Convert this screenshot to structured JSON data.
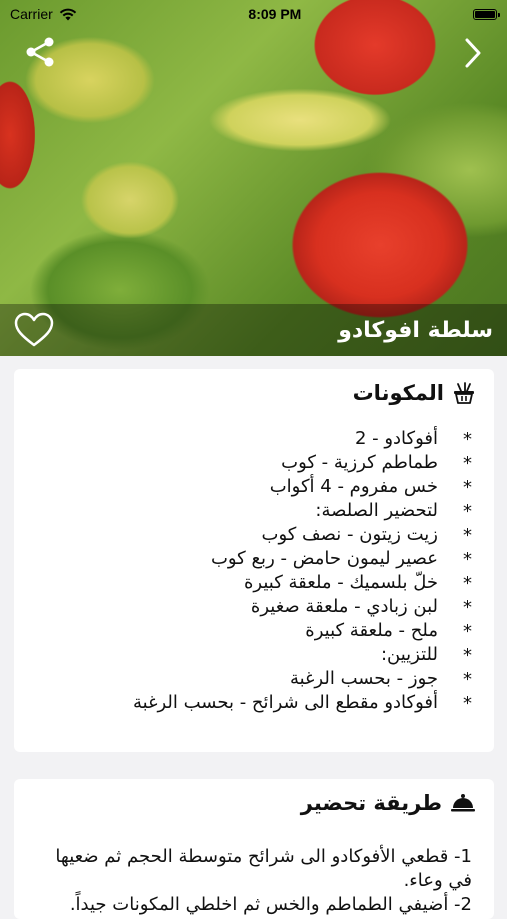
{
  "status_bar": {
    "carrier": "Carrier",
    "time": "8:09 PM"
  },
  "recipe": {
    "title": "سلطة افوكادو"
  },
  "ingredients": {
    "heading": "المكونات",
    "items": [
      "أفوكادو - 2",
      "طماطم كرزية - كوب",
      "خس مفروم - 4 أكواب",
      "لتحضير الصلصة:",
      "زيت زيتون - نصف كوب",
      "عصير ليمون حامض - ربع كوب",
      "خلّ بلسميك - ملعقة كبيرة",
      "لبن زبادي - ملعقة صغيرة",
      "ملح - ملعقة كبيرة",
      "للتزيين:",
      "جوز - بحسب الرغبة",
      "أفوكادو مقطع الى شرائح - بحسب الرغبة"
    ]
  },
  "method": {
    "heading": "طريقة تحضير",
    "steps": [
      "1- قطعي الأفوكادو الى شرائح متوسطة الحجم ثم ضعيها في وعاء.",
      "2- أضيفي الطماطم والخس ثم اخلطي المكونات جيداً."
    ]
  },
  "icons": {
    "share": "share-icon",
    "next": "chevron-right-icon",
    "favorite": "heart-outline-icon",
    "ingredients": "basket-icon",
    "method": "cloche-icon",
    "wifi": "wifi-icon",
    "battery": "battery-icon"
  }
}
